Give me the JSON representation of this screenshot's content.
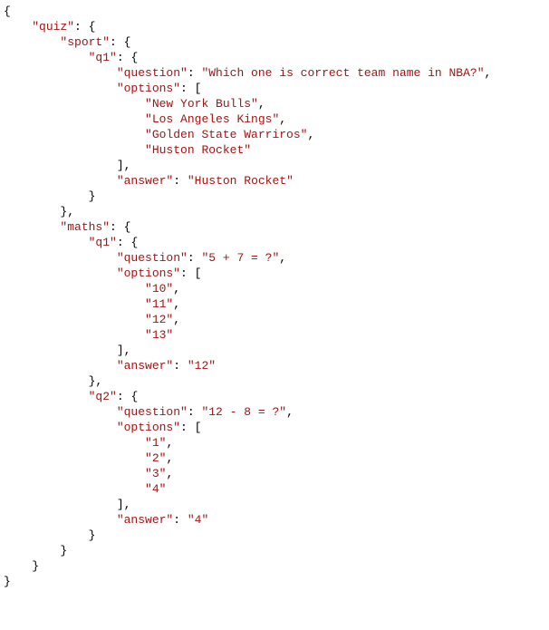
{
  "code_display": {
    "key_quiz": "\"quiz\"",
    "key_sport": "\"sport\"",
    "key_q1": "\"q1\"",
    "key_q2": "\"q2\"",
    "key_question": "\"question\"",
    "key_options": "\"options\"",
    "key_answer": "\"answer\"",
    "key_maths": "\"maths\"",
    "sport_q1_question": "\"Which one is correct team name in NBA?\"",
    "sport_q1_opt1": "\"New York Bulls\"",
    "sport_q1_opt2": "\"Los Angeles Kings\"",
    "sport_q1_opt3": "\"Golden State Warriros\"",
    "sport_q1_opt4": "\"Huston Rocket\"",
    "sport_q1_answer": "\"Huston Rocket\"",
    "maths_q1_question": "\"5 + 7 = ?\"",
    "maths_q1_opt1": "\"10\"",
    "maths_q1_opt2": "\"11\"",
    "maths_q1_opt3": "\"12\"",
    "maths_q1_opt4": "\"13\"",
    "maths_q1_answer": "\"12\"",
    "maths_q2_question": "\"12 - 8 = ?\"",
    "maths_q2_opt1": "\"1\"",
    "maths_q2_opt2": "\"2\"",
    "maths_q2_opt3": "\"3\"",
    "maths_q2_opt4": "\"4\"",
    "maths_q2_answer": "\"4\""
  },
  "json_value": {
    "quiz": {
      "sport": {
        "q1": {
          "question": "Which one is correct team name in NBA?",
          "options": [
            "New York Bulls",
            "Los Angeles Kings",
            "Golden State Warriros",
            "Huston Rocket"
          ],
          "answer": "Huston Rocket"
        }
      },
      "maths": {
        "q1": {
          "question": "5 + 7 = ?",
          "options": [
            "10",
            "11",
            "12",
            "13"
          ],
          "answer": "12"
        },
        "q2": {
          "question": "12 - 8 = ?",
          "options": [
            "1",
            "2",
            "3",
            "4"
          ],
          "answer": "4"
        }
      }
    }
  }
}
